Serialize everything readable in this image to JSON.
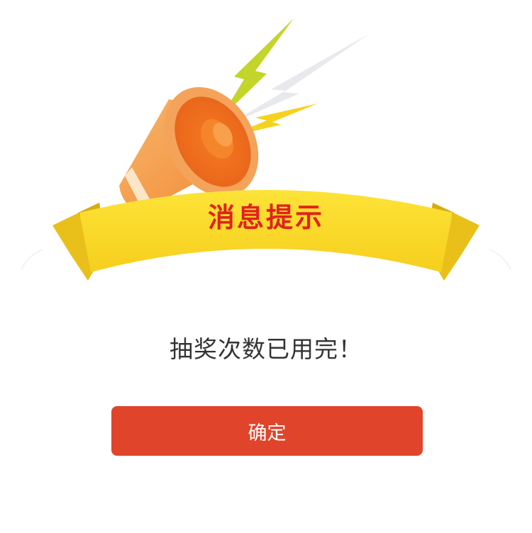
{
  "dialog": {
    "title": "消息提示",
    "message": "抽奖次数已用完！",
    "confirm_label": "确定"
  },
  "icons": {
    "header": "megaphone-icon",
    "ribbon": "ribbon-banner"
  },
  "colors": {
    "title": "#e0231c",
    "button": "#e0452b",
    "button_text": "#ffffff",
    "message_text": "#333333",
    "ribbon": "#fbd92b",
    "megaphone": "#f07f2c"
  }
}
